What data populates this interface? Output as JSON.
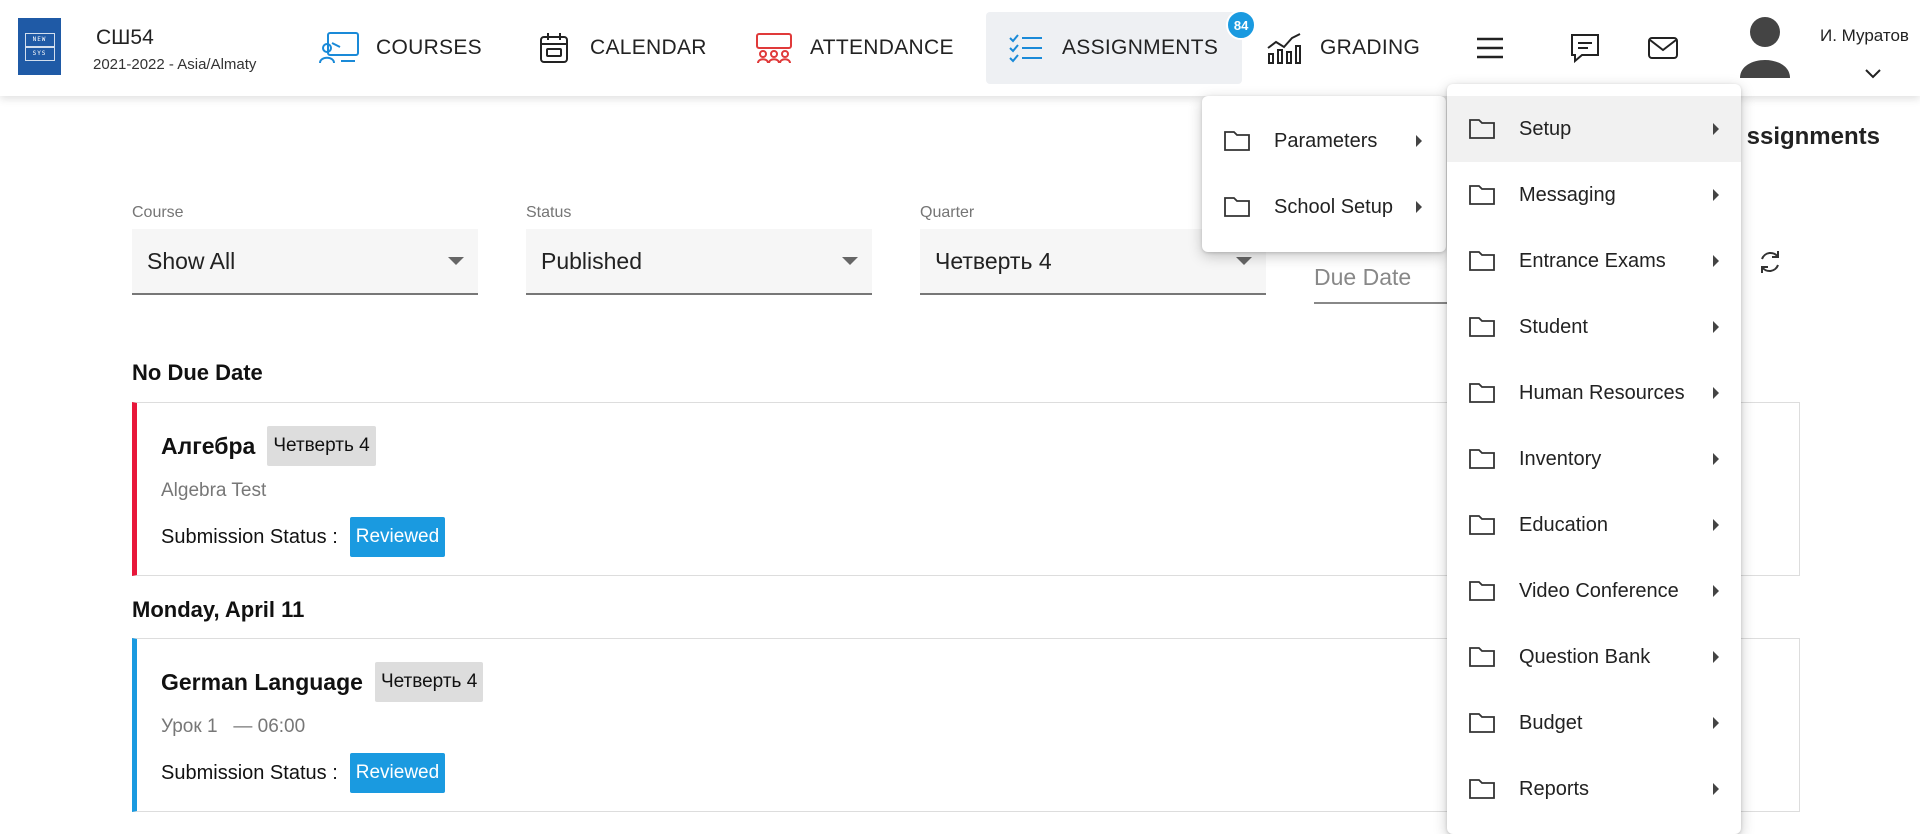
{
  "header": {
    "school_name": "СШ54",
    "school_year": "2021-2022 - Asia/Almaty",
    "logo_text": [
      "NEW",
      "SYS"
    ],
    "nav": {
      "courses": "COURSES",
      "calendar": "CALENDAR",
      "attendance": "ATTENDANCE",
      "assignments": "ASSIGNMENTS",
      "assignments_badge": "84",
      "grading": "GRADING"
    },
    "user_name": "И. Муратов"
  },
  "page": {
    "title": "ssignments",
    "filters": {
      "course": {
        "label": "Course",
        "value": "Show All"
      },
      "status": {
        "label": "Status",
        "value": "Published"
      },
      "quarter": {
        "label": "Quarter",
        "value": "Четверть 4"
      },
      "due_date_placeholder": "Due Date"
    },
    "groups": [
      {
        "title": "No Due Date",
        "card": {
          "name": "Алгебра",
          "quarter": "Четверть 4",
          "subtitle": "Algebra Test",
          "status_label": "Submission Status :",
          "status": "Reviewed"
        }
      },
      {
        "title": "Monday, April 11",
        "card": {
          "name": "German Language",
          "quarter": "Четверть 4",
          "subtitle": "Урок 1   — 06:00",
          "status_label": "Submission Status :",
          "status": "Reviewed"
        }
      }
    ]
  },
  "submenu": {
    "items": [
      "Parameters",
      "School Setup"
    ]
  },
  "menu": {
    "items": [
      "Setup",
      "Messaging",
      "Entrance Exams",
      "Student",
      "Human Resources",
      "Inventory",
      "Education",
      "Video Conference",
      "Question Bank",
      "Budget",
      "Reports"
    ]
  },
  "colors": {
    "accent_blue": "#1a9ae0",
    "attendance_red": "#e03a3a",
    "card_red": "#e8173a",
    "logo_blue": "#1f5aa6"
  }
}
